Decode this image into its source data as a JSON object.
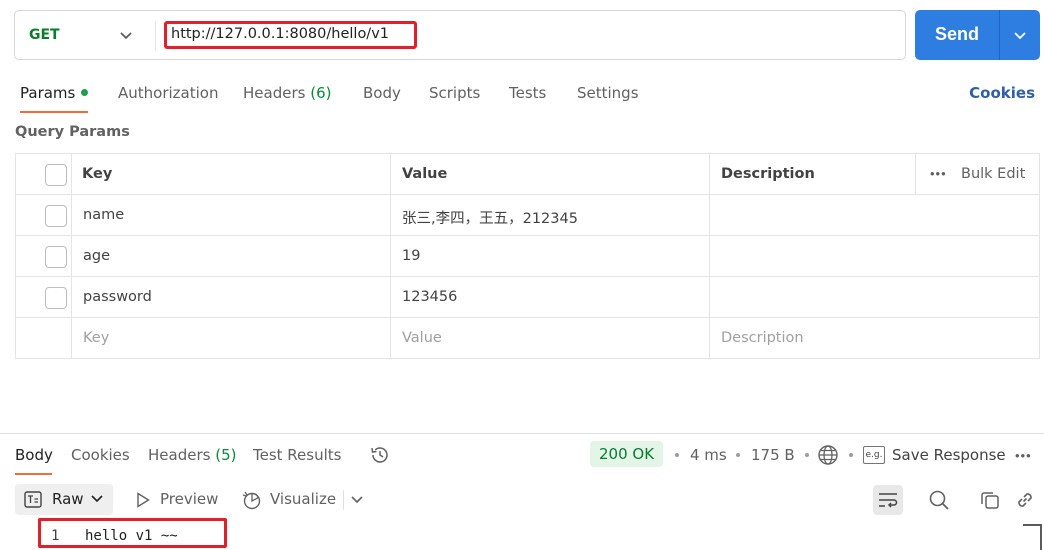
{
  "request": {
    "method": "GET",
    "url": "http://127.0.0.1:8080/hello/v1",
    "send_label": "Send"
  },
  "request_tabs": {
    "params": "Params",
    "authorization": "Authorization",
    "headers": "Headers",
    "headers_count": "(6)",
    "body": "Body",
    "scripts": "Scripts",
    "tests": "Tests",
    "settings": "Settings",
    "cookies": "Cookies"
  },
  "query_params": {
    "title": "Query Params",
    "headers": {
      "key": "Key",
      "value": "Value",
      "description": "Description",
      "bulk_edit": "Bulk Edit"
    },
    "rows": [
      {
        "key": "name",
        "value": "张三,李四，王五，212345",
        "description": ""
      },
      {
        "key": "age",
        "value": "19",
        "description": ""
      },
      {
        "key": "password",
        "value": "123456",
        "description": ""
      }
    ],
    "placeholders": {
      "key": "Key",
      "value": "Value",
      "description": "Description"
    }
  },
  "response_tabs": {
    "body": "Body",
    "cookies": "Cookies",
    "headers": "Headers",
    "headers_count": "(5)",
    "test_results": "Test Results"
  },
  "response_meta": {
    "status": "200 OK",
    "time": "4 ms",
    "size": "175 B",
    "save_response": "Save Response",
    "eg_label": "e.g."
  },
  "response_toolbar": {
    "raw": "Raw",
    "preview": "Preview",
    "visualize": "Visualize"
  },
  "response_body": {
    "line_number": "1",
    "line_text": "hello v1 ~~"
  },
  "colors": {
    "send_button": "#2e7de1",
    "method_get": "#0a7d2c",
    "active_tab_underline": "#f26b3a",
    "status_ok_bg": "#e3f5e6",
    "annotation_red": "#e0202a"
  },
  "icons": [
    "chevron-down-icon",
    "history-icon",
    "globe-icon",
    "raw-format-icon",
    "play-icon",
    "visualize-icon",
    "wrap-lines-icon",
    "search-icon",
    "copy-icon",
    "link-icon",
    "more-icon"
  ]
}
